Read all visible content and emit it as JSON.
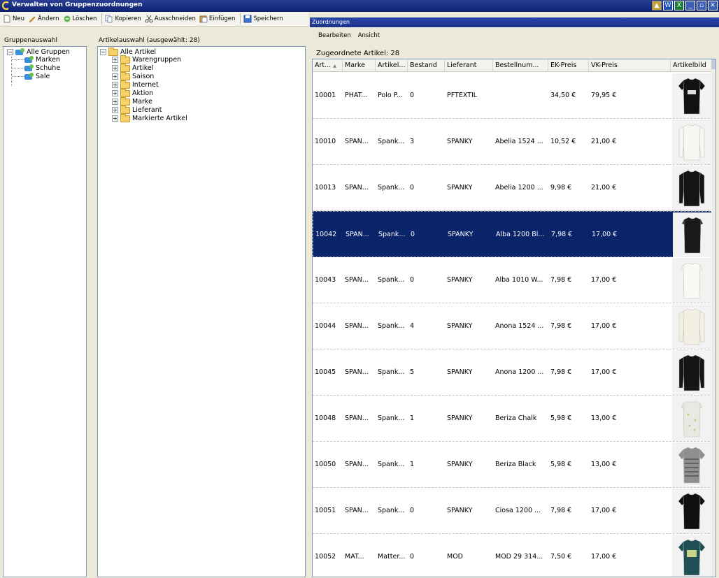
{
  "window": {
    "title": "Verwalten von Gruppenzuordnungen"
  },
  "toolbar": {
    "items": [
      {
        "label": "Neu",
        "icon": "new-document-icon"
      },
      {
        "label": "Ändern",
        "icon": "edit-icon"
      },
      {
        "label": "Löschen",
        "icon": "delete-icon"
      },
      {
        "label": "Kopieren",
        "icon": "copy-icon"
      },
      {
        "label": "Ausschneiden",
        "icon": "cut-icon"
      },
      {
        "label": "Einfügen",
        "icon": "paste-icon"
      },
      {
        "label": "Speichern",
        "icon": "save-icon"
      }
    ]
  },
  "group_panel": {
    "title": "Gruppenauswahl",
    "root": "Alle Gruppen",
    "children": [
      "Marken",
      "Schuhe",
      "Sale"
    ]
  },
  "article_panel": {
    "title": "Artikelauswahl  (ausgewählt: 28)",
    "root": "Alle Artikel",
    "children": [
      "Warengruppen",
      "Artikel",
      "Saison",
      "Internet",
      "Aktion",
      "Marke",
      "Lieferant",
      "Markierte Artikel"
    ]
  },
  "right": {
    "header": "Zuordnungen",
    "menu": [
      "Bearbeiten",
      "Ansicht"
    ],
    "grid_title": "Zugeordnete Artikel: 28",
    "columns": [
      "Art...",
      "Marke",
      "Artikel...",
      "Bestand",
      "Lieferant",
      "Bestellnum...",
      "EK-Preis",
      "VK-Preis",
      "Artikelbild"
    ],
    "sort_indicator": "▲",
    "rows": [
      {
        "art": "10001",
        "marke": "PHAT...",
        "artikel": "Polo P...",
        "bestand": "0",
        "lieferant": "PFTEXTIL",
        "bestellnr": "",
        "ek": "34,50 €",
        "vk": "79,95 €",
        "img": "black-tshirt"
      },
      {
        "art": "10010",
        "marke": "SPAN...",
        "artikel": "Spank...",
        "bestand": "3",
        "lieferant": "SPANKY",
        "bestellnr": "Abelia 1524 ...",
        "ek": "10,52 €",
        "vk": "21,00 €",
        "img": "white-longsleeve"
      },
      {
        "art": "10013",
        "marke": "SPAN...",
        "artikel": "Spank...",
        "bestand": "0",
        "lieferant": "SPANKY",
        "bestellnr": "Abelia 1200 ...",
        "ek": "9,98 €",
        "vk": "21,00 €",
        "img": "black-longsleeve"
      },
      {
        "art": "10042",
        "marke": "SPAN...",
        "artikel": "Spank...",
        "bestand": "0",
        "lieferant": "SPANKY",
        "bestellnr": "Alba 1200 Bl...",
        "ek": "7,98 €",
        "vk": "17,00 €",
        "img": "black-top",
        "selected": true
      },
      {
        "art": "10043",
        "marke": "SPAN...",
        "artikel": "Spank...",
        "bestand": "0",
        "lieferant": "SPANKY",
        "bestellnr": "Alba 1010 W...",
        "ek": "7,98 €",
        "vk": "17,00 €",
        "img": "white-top"
      },
      {
        "art": "10044",
        "marke": "SPAN...",
        "artikel": "Spank...",
        "bestand": "4",
        "lieferant": "SPANKY",
        "bestellnr": "Anona 1524 ...",
        "ek": "7,98 €",
        "vk": "17,00 €",
        "img": "cream-longsleeve"
      },
      {
        "art": "10045",
        "marke": "SPAN...",
        "artikel": "Spank...",
        "bestand": "5",
        "lieferant": "SPANKY",
        "bestellnr": "Anona 1200 ...",
        "ek": "7,98 €",
        "vk": "17,00 €",
        "img": "black-longsleeve"
      },
      {
        "art": "10048",
        "marke": "SPAN...",
        "artikel": "Spank...",
        "bestand": "1",
        "lieferant": "SPANKY",
        "bestellnr": "Beriza Chalk",
        "ek": "5,98 €",
        "vk": "13,00 €",
        "img": "patterned-tee"
      },
      {
        "art": "10050",
        "marke": "SPAN...",
        "artikel": "Spank...",
        "bestand": "1",
        "lieferant": "SPANKY",
        "bestellnr": "Beriza Black",
        "ek": "5,98 €",
        "vk": "13,00 €",
        "img": "striped-tee"
      },
      {
        "art": "10051",
        "marke": "SPAN...",
        "artikel": "Spank...",
        "bestand": "0",
        "lieferant": "SPANKY",
        "bestellnr": "Ciosa 1200 ...",
        "ek": "7,98 €",
        "vk": "17,00 €",
        "img": "black-tee"
      },
      {
        "art": "10052",
        "marke": "MAT...",
        "artikel": "Matter...",
        "bestand": "0",
        "lieferant": "MOD",
        "bestellnr": "MOD 29 314...",
        "ek": "7,50 €",
        "vk": "17,00 €",
        "img": "teal-print-tee"
      }
    ]
  },
  "colors": {
    "titlebar": "#0b2272",
    "selection": "#0a246a",
    "panel_border": "#7f9db9",
    "window_bg": "#ece9d8"
  }
}
